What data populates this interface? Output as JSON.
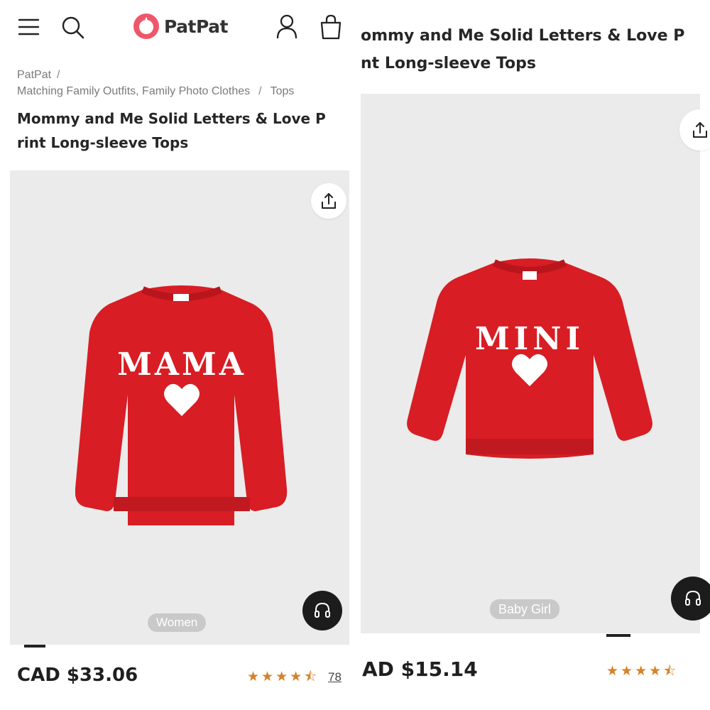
{
  "header": {
    "brand": "PatPat",
    "menu_icon": "hamburger-menu-icon",
    "search_icon": "search-icon",
    "account_icon": "user-icon",
    "cart_icon": "shopping-bag-icon"
  },
  "breadcrumb": {
    "items": [
      "PatPat",
      "Matching Family Outfits, Family Photo Clothes",
      "Tops"
    ],
    "separator": "/"
  },
  "left_product": {
    "title_line1": "Mommy and Me Solid Letters & Love P",
    "title_line2": "rint Long-sleeve Tops",
    "print_text": "MAMA",
    "chip": "Women",
    "price": "CAD $33.06",
    "rating": 4.5,
    "review_count": "78"
  },
  "right_product": {
    "title_line1": "ommy and Me Solid Letters & Love P",
    "title_line2": "nt Long-sleeve Tops",
    "print_text": "MINI",
    "chip": "Baby Girl",
    "price": "AD $15.14",
    "rating": 4.5
  },
  "colors": {
    "brand_pink": "#f0566a",
    "sweater_red": "#d81d24",
    "star_orange": "#d5822a",
    "gallery_bg": "#ebebeb"
  }
}
